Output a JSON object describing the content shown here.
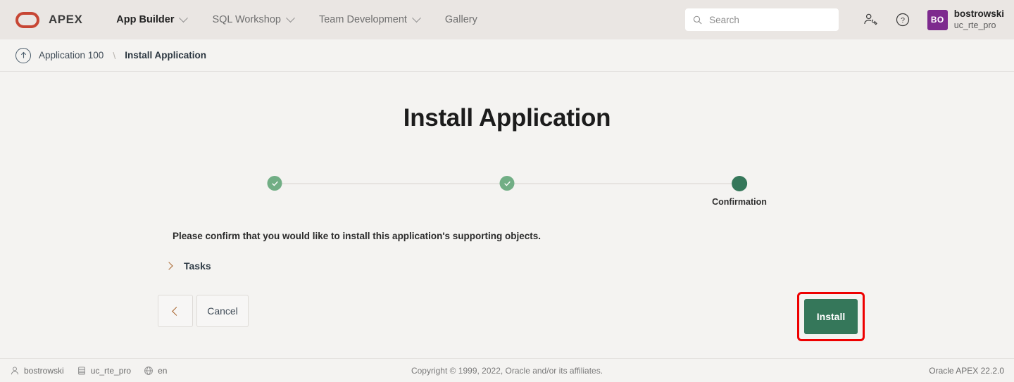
{
  "header": {
    "brand": "APEX",
    "logo_color": "#c74634",
    "nav": [
      {
        "label": "App Builder",
        "has_caret": true,
        "active": true
      },
      {
        "label": "SQL Workshop",
        "has_caret": true,
        "active": false
      },
      {
        "label": "Team Development",
        "has_caret": true,
        "active": false
      },
      {
        "label": "Gallery",
        "has_caret": false,
        "active": false
      }
    ],
    "search": {
      "value": "",
      "placeholder": "Search"
    },
    "admin_icon": "user-settings-icon",
    "help_icon": "help-circle-icon",
    "user": {
      "initials": "BO",
      "name": "bostrowski",
      "workspace": "uc_rte_pro",
      "avatar_color": "#7d2a8e"
    }
  },
  "breadcrumb": {
    "up_icon": "arrow-up-circle-icon",
    "items": [
      {
        "label": "Application 100",
        "current": false
      },
      {
        "label": "Install Application",
        "current": true
      }
    ],
    "separator": "\\"
  },
  "main": {
    "title": "Install Application",
    "progress": {
      "steps": [
        {
          "label": "",
          "state": "done",
          "position": 0
        },
        {
          "label": "",
          "state": "done",
          "position": 50
        },
        {
          "label": "Confirmation",
          "state": "current",
          "position": 100
        }
      ],
      "done_color": "#71ae85",
      "current_color": "#35775a"
    },
    "confirm_message": "Please confirm that you would like to install this application's supporting objects.",
    "tasks": {
      "label": "Tasks",
      "expanded": false,
      "chevron_icon": "chevron-right-icon"
    },
    "buttons": {
      "previous_icon": "chevron-left-icon",
      "cancel_label": "Cancel",
      "install_label": "Install",
      "install_color": "#35775a",
      "highlight_color": "#ee0000"
    }
  },
  "footer": {
    "user": "bostrowski",
    "workspace": "uc_rte_pro",
    "language": "en",
    "copyright": "Copyright © 1999, 2022, Oracle and/or its affiliates.",
    "version": "Oracle APEX 22.2.0"
  }
}
